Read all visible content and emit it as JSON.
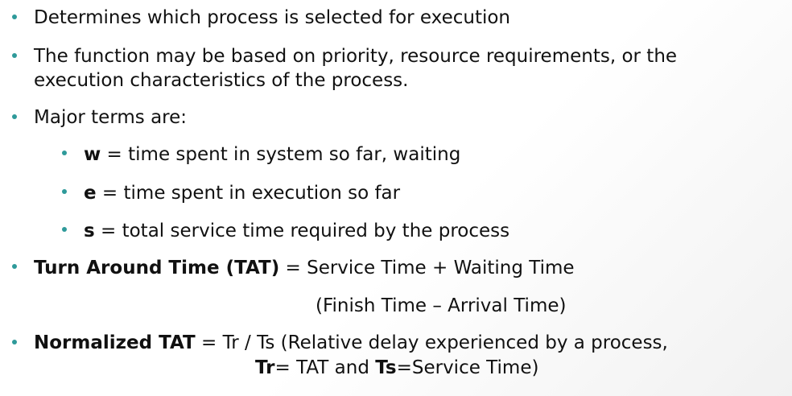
{
  "bullets": {
    "b1": {
      "text": "Determines which process is selected for execution"
    },
    "b2": {
      "line1": "The function may be based on priority, resource requirements, or the",
      "line2": "execution characteristics of the process."
    },
    "b3": {
      "text": "Major terms are:"
    },
    "sub": {
      "w": {
        "term": "w",
        "text": " = time spent in system so far, waiting"
      },
      "e": {
        "term": "e",
        "text": " = time spent in execution so far"
      },
      "s": {
        "term": "s",
        "text": " = total service time required by the process"
      }
    },
    "tat": {
      "term": "Turn Around Time (TAT)",
      "text": " = Service Time + Waiting Time",
      "line2": "(Finish Time – Arrival Time)"
    },
    "ntat": {
      "term": "Normalized TAT",
      "text": " = Tr / Ts (Relative delay experienced by a process,",
      "tr_term": "Tr",
      "tr_text": "= TAT and ",
      "ts_term": "Ts",
      "ts_text": "=Service Time)"
    }
  },
  "colors": {
    "bullet": "#2e9a9a",
    "text": "#111111"
  }
}
